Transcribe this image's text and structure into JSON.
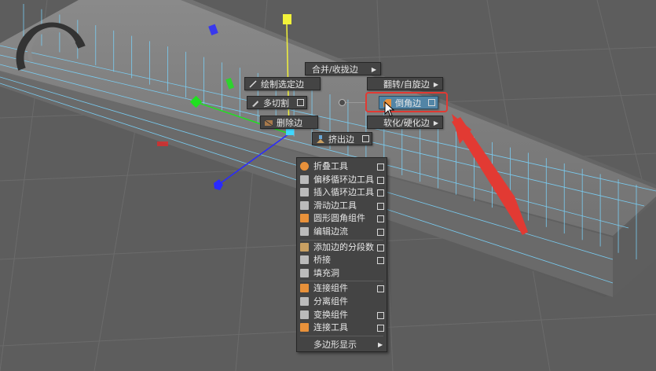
{
  "marking_menu": {
    "merge_collapse": "合并/收拢边",
    "draw_select_edge": "绘制选定边",
    "flip_spin_edge": "翻转/自旋边",
    "multi_cut": "多切割",
    "bevel_edge": "倒角边",
    "delete_edge": "删除边",
    "soften_harden_edge": "软化/硬化边",
    "extrude_edge": "挤出边"
  },
  "context_menu": {
    "items": [
      {
        "label": "折叠工具",
        "icon": "crease-tool-icon",
        "has_option": true
      },
      {
        "label": "偏移循环边工具",
        "icon": "offset-edge-loop-icon",
        "has_option": true
      },
      {
        "label": "插入循环边工具",
        "icon": "insert-edge-loop-icon",
        "has_option": true
      },
      {
        "label": "滑动边工具",
        "icon": "slide-edge-icon",
        "has_option": true
      },
      {
        "label": "圆形圆角组件",
        "icon": "circularize-icon",
        "has_option": true
      },
      {
        "label": "编辑边流",
        "icon": "edit-edge-flow-icon",
        "has_option": true
      },
      {
        "label": "添加边的分段数",
        "icon": "add-divisions-icon",
        "has_option": true
      },
      {
        "label": "桥接",
        "icon": "bridge-icon",
        "has_option": true
      },
      {
        "label": "填充洞",
        "icon": "fill-hole-icon",
        "has_option": false
      },
      {
        "label": "连接组件",
        "icon": "connect-components-icon",
        "has_option": true
      },
      {
        "label": "分离组件",
        "icon": "detach-components-icon",
        "has_option": false
      },
      {
        "label": "变换组件",
        "icon": "transform-components-icon",
        "has_option": true
      },
      {
        "label": "连接工具",
        "icon": "connect-tool-icon",
        "has_option": true
      }
    ],
    "submenu_label": "多边形显示"
  },
  "colors": {
    "viewport_bg": "#5d5d5d",
    "grid": "#6b6b6b",
    "mesh_wire": "#7ad6ff",
    "menu_bg": "#444444",
    "highlight": "#5285a6",
    "annotation_red": "#e23a33",
    "gizmo_x": "#e02b2b",
    "gizmo_y": "#f2f23a",
    "gizmo_z": "#2a2aff",
    "gizmo_green": "#20e020"
  }
}
